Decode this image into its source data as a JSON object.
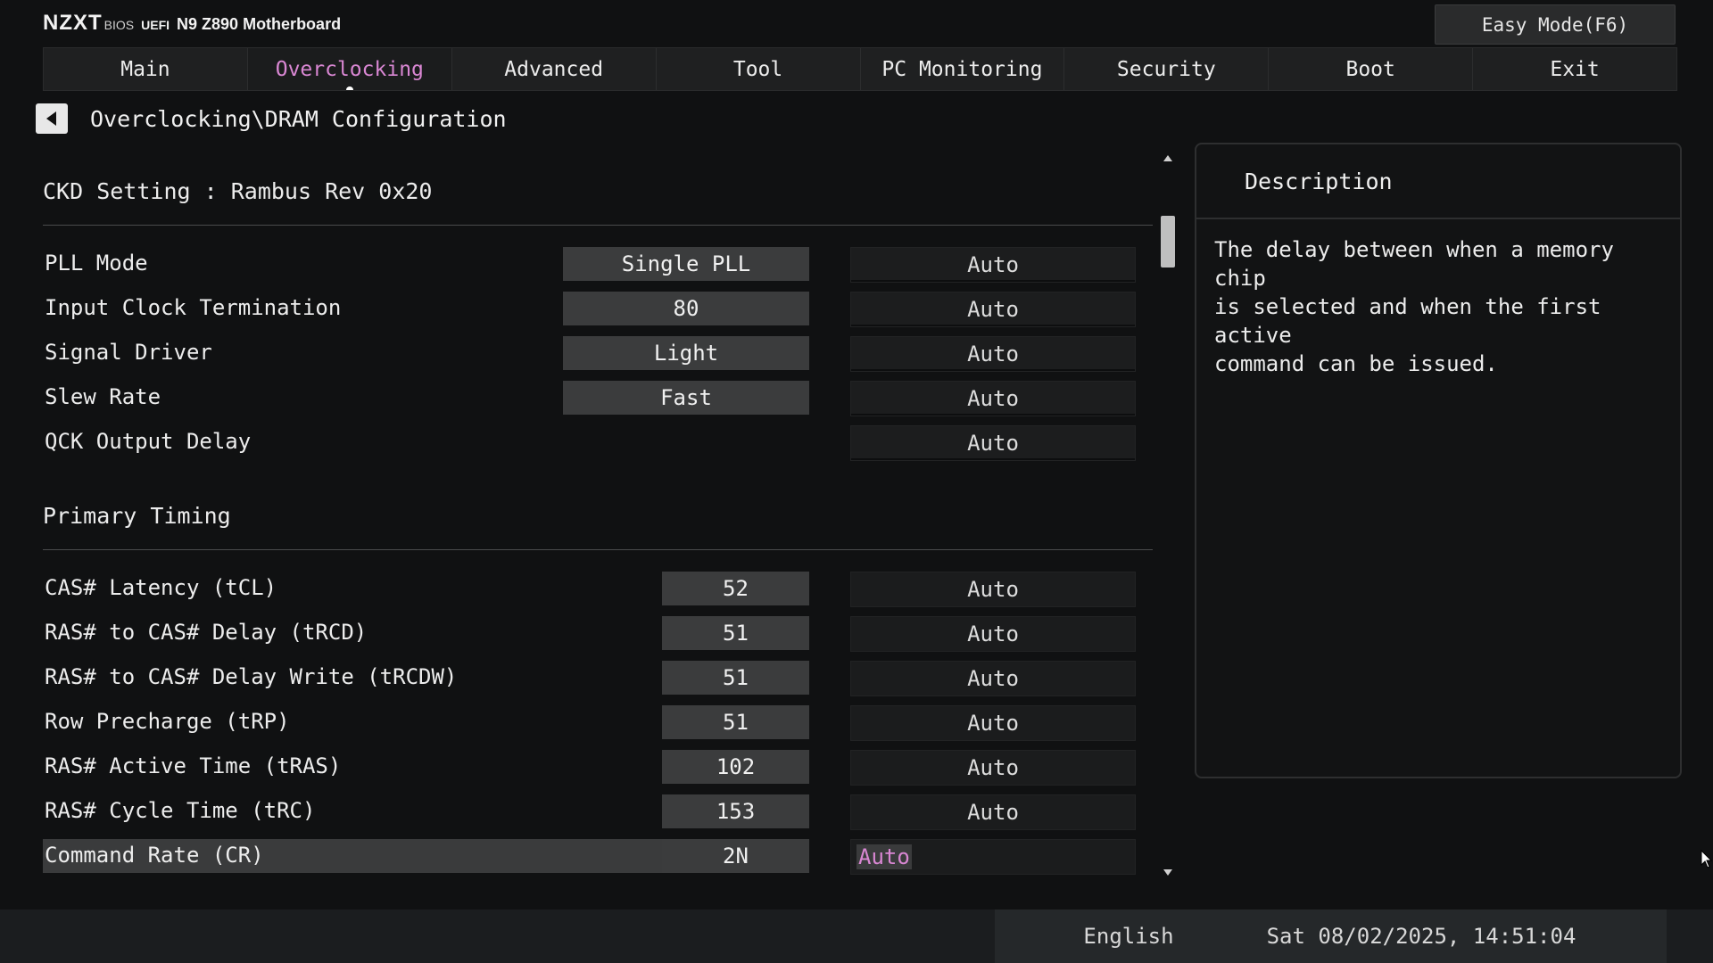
{
  "header": {
    "brand": "NZXT",
    "bios": "BIOS",
    "uefi": "UEFI",
    "model": "N9 Z890 Motherboard",
    "easy_mode_label": "Easy Mode(F6)"
  },
  "tabs": [
    {
      "label": "Main",
      "active": false
    },
    {
      "label": "Overclocking",
      "active": true
    },
    {
      "label": "Advanced",
      "active": false
    },
    {
      "label": "Tool",
      "active": false
    },
    {
      "label": "PC Monitoring",
      "active": false
    },
    {
      "label": "Security",
      "active": false
    },
    {
      "label": "Boot",
      "active": false
    },
    {
      "label": "Exit",
      "active": false
    }
  ],
  "breadcrumb": "Overclocking\\DRAM Configuration",
  "ckd": {
    "title": "CKD Setting : Rambus Rev 0x20",
    "rows": [
      {
        "label": "PLL Mode",
        "value": "Single PLL",
        "option": "Auto"
      },
      {
        "label": "Input Clock Termination",
        "value": "80",
        "option": "Auto"
      },
      {
        "label": "Signal Driver",
        "value": "Light",
        "option": "Auto"
      },
      {
        "label": "Slew Rate",
        "value": "Fast",
        "option": "Auto"
      },
      {
        "label": "QCK Output Delay",
        "value": "",
        "option": "Auto"
      }
    ]
  },
  "primary": {
    "title": "Primary Timing",
    "rows": [
      {
        "label": "CAS# Latency (tCL)",
        "value": "52",
        "option": "Auto"
      },
      {
        "label": "RAS# to CAS# Delay (tRCD)",
        "value": "51",
        "option": "Auto"
      },
      {
        "label": "RAS# to CAS# Delay Write (tRCDW)",
        "value": "51",
        "option": "Auto"
      },
      {
        "label": "Row Precharge (tRP)",
        "value": "51",
        "option": "Auto"
      },
      {
        "label": "RAS# Active Time (tRAS)",
        "value": "102",
        "option": "Auto"
      },
      {
        "label": "RAS# Cycle Time (tRC)",
        "value": "153",
        "option": "Auto"
      },
      {
        "label": "Command Rate (CR)",
        "value": "2N",
        "option": "Auto",
        "selected": true
      }
    ]
  },
  "description": {
    "title": "Description",
    "text_lines": [
      "The delay between when a memory chip",
      "is selected and when the first active",
      "command can be issued."
    ]
  },
  "footer": {
    "language": "English",
    "datetime": "Sat 08/02/2025, 14:51:04"
  },
  "colors": {
    "accent": "#d987d3",
    "background": "#101112"
  }
}
